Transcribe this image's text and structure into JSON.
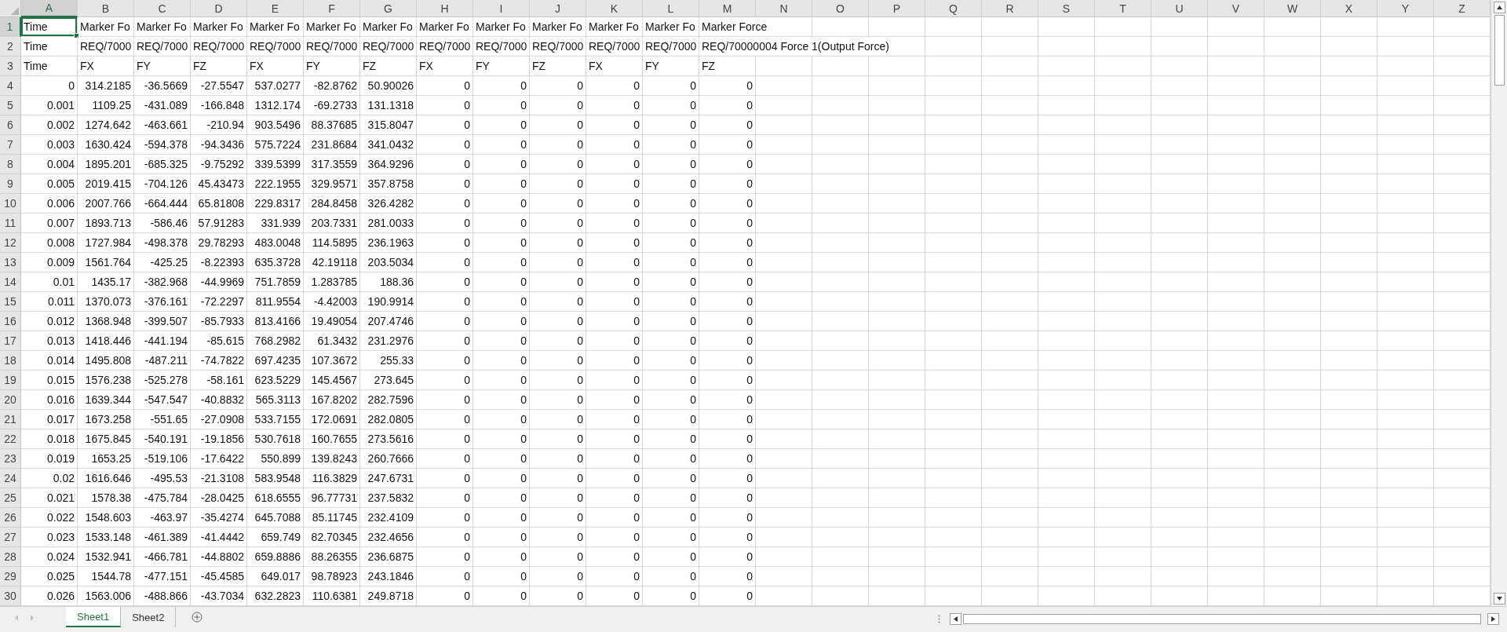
{
  "columns": [
    {
      "letter": "A",
      "selected": true
    },
    {
      "letter": "B",
      "selected": false
    },
    {
      "letter": "C",
      "selected": false
    },
    {
      "letter": "D",
      "selected": false
    },
    {
      "letter": "E",
      "selected": false
    },
    {
      "letter": "F",
      "selected": false
    },
    {
      "letter": "G",
      "selected": false
    },
    {
      "letter": "H",
      "selected": false
    },
    {
      "letter": "I",
      "selected": false
    },
    {
      "letter": "J",
      "selected": false
    },
    {
      "letter": "K",
      "selected": false
    },
    {
      "letter": "L",
      "selected": false
    },
    {
      "letter": "M",
      "selected": false
    },
    {
      "letter": "N",
      "selected": false
    },
    {
      "letter": "O",
      "selected": false
    },
    {
      "letter": "P",
      "selected": false
    },
    {
      "letter": "Q",
      "selected": false
    },
    {
      "letter": "R",
      "selected": false
    },
    {
      "letter": "S",
      "selected": false
    },
    {
      "letter": "T",
      "selected": false
    },
    {
      "letter": "U",
      "selected": false
    },
    {
      "letter": "V",
      "selected": false
    },
    {
      "letter": "W",
      "selected": false
    },
    {
      "letter": "X",
      "selected": false
    },
    {
      "letter": "Y",
      "selected": false
    },
    {
      "letter": "Z",
      "selected": false
    }
  ],
  "rows": [
    {
      "number": "1",
      "selected": true,
      "cells": [
        "Time",
        "Marker Fo",
        "Marker Fo",
        "Marker Fo",
        "Marker Fo",
        "Marker Fo",
        "Marker Fo",
        "Marker Fo",
        "Marker Fo",
        "Marker Fo",
        "Marker Fo",
        "Marker Fo",
        "Marker Force"
      ]
    },
    {
      "number": "2",
      "selected": false,
      "cells": [
        "Time",
        "REQ/7000",
        "REQ/7000",
        "REQ/7000",
        "REQ/7000",
        "REQ/7000",
        "REQ/7000",
        "REQ/7000",
        "REQ/7000",
        "REQ/7000",
        "REQ/7000",
        "REQ/7000",
        "REQ/70000004 Force 1(Output Force)"
      ]
    },
    {
      "number": "3",
      "selected": false,
      "cells": [
        "Time",
        "FX",
        "FY",
        "FZ",
        "FX",
        "FY",
        "FZ",
        "FX",
        "FY",
        "FZ",
        "FX",
        "FY",
        "FZ"
      ]
    },
    {
      "number": "4",
      "selected": false,
      "cells": [
        "0",
        "314.2185",
        "-36.5669",
        "-27.5547",
        "537.0277",
        "-82.8762",
        "50.90026",
        "0",
        "0",
        "0",
        "0",
        "0",
        "0"
      ]
    },
    {
      "number": "5",
      "selected": false,
      "cells": [
        "0.001",
        "1109.25",
        "-431.089",
        "-166.848",
        "1312.174",
        "-69.2733",
        "131.1318",
        "0",
        "0",
        "0",
        "0",
        "0",
        "0"
      ]
    },
    {
      "number": "6",
      "selected": false,
      "cells": [
        "0.002",
        "1274.642",
        "-463.661",
        "-210.94",
        "903.5496",
        "88.37685",
        "315.8047",
        "0",
        "0",
        "0",
        "0",
        "0",
        "0"
      ]
    },
    {
      "number": "7",
      "selected": false,
      "cells": [
        "0.003",
        "1630.424",
        "-594.378",
        "-94.3436",
        "575.7224",
        "231.8684",
        "341.0432",
        "0",
        "0",
        "0",
        "0",
        "0",
        "0"
      ]
    },
    {
      "number": "8",
      "selected": false,
      "cells": [
        "0.004",
        "1895.201",
        "-685.325",
        "-9.75292",
        "339.5399",
        "317.3559",
        "364.9296",
        "0",
        "0",
        "0",
        "0",
        "0",
        "0"
      ]
    },
    {
      "number": "9",
      "selected": false,
      "cells": [
        "0.005",
        "2019.415",
        "-704.126",
        "45.43473",
        "222.1955",
        "329.9571",
        "357.8758",
        "0",
        "0",
        "0",
        "0",
        "0",
        "0"
      ]
    },
    {
      "number": "10",
      "selected": false,
      "cells": [
        "0.006",
        "2007.766",
        "-664.444",
        "65.81808",
        "229.8317",
        "284.8458",
        "326.4282",
        "0",
        "0",
        "0",
        "0",
        "0",
        "0"
      ]
    },
    {
      "number": "11",
      "selected": false,
      "cells": [
        "0.007",
        "1893.713",
        "-586.46",
        "57.91283",
        "331.939",
        "203.7331",
        "281.0033",
        "0",
        "0",
        "0",
        "0",
        "0",
        "0"
      ]
    },
    {
      "number": "12",
      "selected": false,
      "cells": [
        "0.008",
        "1727.984",
        "-498.378",
        "29.78293",
        "483.0048",
        "114.5895",
        "236.1963",
        "0",
        "0",
        "0",
        "0",
        "0",
        "0"
      ]
    },
    {
      "number": "13",
      "selected": false,
      "cells": [
        "0.009",
        "1561.764",
        "-425.25",
        "-8.22393",
        "635.3728",
        "42.19118",
        "203.5034",
        "0",
        "0",
        "0",
        "0",
        "0",
        "0"
      ]
    },
    {
      "number": "14",
      "selected": false,
      "cells": [
        "0.01",
        "1435.17",
        "-382.968",
        "-44.9969",
        "751.7859",
        "1.283785",
        "188.36",
        "0",
        "0",
        "0",
        "0",
        "0",
        "0"
      ]
    },
    {
      "number": "15",
      "selected": false,
      "cells": [
        "0.011",
        "1370.073",
        "-376.161",
        "-72.2297",
        "811.9554",
        "-4.42003",
        "190.9914",
        "0",
        "0",
        "0",
        "0",
        "0",
        "0"
      ]
    },
    {
      "number": "16",
      "selected": false,
      "cells": [
        "0.012",
        "1368.948",
        "-399.507",
        "-85.7933",
        "813.4166",
        "19.49054",
        "207.4746",
        "0",
        "0",
        "0",
        "0",
        "0",
        "0"
      ]
    },
    {
      "number": "17",
      "selected": false,
      "cells": [
        "0.013",
        "1418.446",
        "-441.194",
        "-85.615",
        "768.2982",
        "61.3432",
        "231.2976",
        "0",
        "0",
        "0",
        "0",
        "0",
        "0"
      ]
    },
    {
      "number": "18",
      "selected": false,
      "cells": [
        "0.014",
        "1495.808",
        "-487.211",
        "-74.7822",
        "697.4235",
        "107.3672",
        "255.33",
        "0",
        "0",
        "0",
        "0",
        "0",
        "0"
      ]
    },
    {
      "number": "19",
      "selected": false,
      "cells": [
        "0.015",
        "1576.238",
        "-525.278",
        "-58.161",
        "623.5229",
        "145.4567",
        "273.645",
        "0",
        "0",
        "0",
        "0",
        "0",
        "0"
      ]
    },
    {
      "number": "20",
      "selected": false,
      "cells": [
        "0.016",
        "1639.344",
        "-547.547",
        "-40.8832",
        "565.3113",
        "167.8202",
        "282.7596",
        "0",
        "0",
        "0",
        "0",
        "0",
        "0"
      ]
    },
    {
      "number": "21",
      "selected": false,
      "cells": [
        "0.017",
        "1673.258",
        "-551.65",
        "-27.0908",
        "533.7155",
        "172.0691",
        "282.0805",
        "0",
        "0",
        "0",
        "0",
        "0",
        "0"
      ]
    },
    {
      "number": "22",
      "selected": false,
      "cells": [
        "0.018",
        "1675.845",
        "-540.191",
        "-19.1856",
        "530.7618",
        "160.7655",
        "273.5616",
        "0",
        "0",
        "0",
        "0",
        "0",
        "0"
      ]
    },
    {
      "number": "23",
      "selected": false,
      "cells": [
        "0.019",
        "1653.25",
        "-519.106",
        "-17.6422",
        "550.899",
        "139.8243",
        "260.7666",
        "0",
        "0",
        "0",
        "0",
        "0",
        "0"
      ]
    },
    {
      "number": "24",
      "selected": false,
      "cells": [
        "0.02",
        "1616.646",
        "-495.53",
        "-21.3108",
        "583.9548",
        "116.3829",
        "247.6731",
        "0",
        "0",
        "0",
        "0",
        "0",
        "0"
      ]
    },
    {
      "number": "25",
      "selected": false,
      "cells": [
        "0.021",
        "1578.38",
        "-475.784",
        "-28.0425",
        "618.6555",
        "96.77731",
        "237.5832",
        "0",
        "0",
        "0",
        "0",
        "0",
        "0"
      ]
    },
    {
      "number": "26",
      "selected": false,
      "cells": [
        "0.022",
        "1548.603",
        "-463.97",
        "-35.4274",
        "645.7088",
        "85.11745",
        "232.4109",
        "0",
        "0",
        "0",
        "0",
        "0",
        "0"
      ]
    },
    {
      "number": "27",
      "selected": false,
      "cells": [
        "0.023",
        "1533.148",
        "-461.389",
        "-41.4442",
        "659.749",
        "82.70345",
        "232.4656",
        "0",
        "0",
        "0",
        "0",
        "0",
        "0"
      ]
    },
    {
      "number": "28",
      "selected": false,
      "cells": [
        "0.024",
        "1532.941",
        "-466.781",
        "-44.8802",
        "659.8886",
        "88.26355",
        "236.6875",
        "0",
        "0",
        "0",
        "0",
        "0",
        "0"
      ]
    },
    {
      "number": "29",
      "selected": false,
      "cells": [
        "0.025",
        "1544.78",
        "-477.151",
        "-45.4585",
        "649.017",
        "98.78923",
        "243.1846",
        "0",
        "0",
        "0",
        "0",
        "0",
        "0"
      ]
    },
    {
      "number": "30",
      "selected": false,
      "cells": [
        "0.026",
        "1563.006",
        "-488.866",
        "-43.7034",
        "632.2823",
        "110.6381",
        "249.8718",
        "0",
        "0",
        "0",
        "0",
        "0",
        "0"
      ]
    }
  ],
  "sheet_tabs": [
    {
      "label": "Sheet1",
      "selected": true
    },
    {
      "label": "Sheet2",
      "selected": false
    }
  ]
}
